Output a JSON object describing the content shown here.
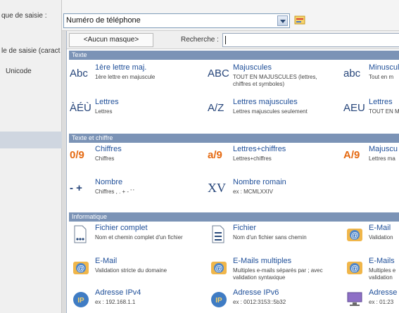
{
  "left_panel": {
    "rows": [
      "que de saisie :",
      "le de saisie (caract",
      "Unicode"
    ]
  },
  "combo": {
    "value": "Numéro de téléphone"
  },
  "toolbar": {
    "no_mask_label": "<Aucun masque>",
    "search_label": "Recherche :",
    "search_value": ""
  },
  "sections": [
    "Texte",
    "Texte et chiffre",
    "Informatique"
  ],
  "items": {
    "texte": [
      {
        "icon": "Abc",
        "title": "1ère lettre maj.",
        "desc": "1ère lettre en majuscule",
        "desc2": ""
      },
      {
        "icon": "ABC",
        "title": "Majuscules",
        "desc": "TOUT EN MAJUSCULES (lettres,",
        "desc2": "chiffres et symboles)"
      },
      {
        "icon": "abc",
        "title": "Minuscul",
        "desc": "Tout en m",
        "desc2": ""
      },
      {
        "icon": "ÀÉÙ",
        "title": "Lettres",
        "desc": "Lettres",
        "desc2": ""
      },
      {
        "icon": "A/Z",
        "title": "Lettres majuscules",
        "desc": "Lettres majuscules seulement",
        "desc2": ""
      },
      {
        "icon": "AEU",
        "title": "Lettres",
        "desc": "TOUT EN M",
        "desc2": ""
      }
    ],
    "texte_chiffre": [
      {
        "icon": "0/9",
        "title": "Chiffres",
        "desc": "Chiffres",
        "desc2": ""
      },
      {
        "icon": "a/9",
        "title": "Lettres+chiffres",
        "desc": "Lettres+chiffres",
        "desc2": ""
      },
      {
        "icon": "A/9",
        "title": "Majuscu",
        "desc": "Lettres ma",
        "desc2": ""
      },
      {
        "icon": "- +",
        "title": "Nombre",
        "desc": "Chiffres , . + - ' '",
        "desc2": ""
      },
      {
        "icon": "XV",
        "title": "Nombre romain",
        "desc": "ex : MCMLXXIV",
        "desc2": ""
      }
    ],
    "informatique": [
      {
        "icon": "file-dots-icon",
        "title": "Fichier complet",
        "desc": "Nom et chemin complet d'un fichier",
        "desc2": ""
      },
      {
        "icon": "file-lines-icon",
        "title": "Fichier",
        "desc": "Nom d'un fichier sans chemin",
        "desc2": ""
      },
      {
        "icon": "at-icon",
        "title": "E-Mail",
        "desc": "Validation",
        "desc2": ""
      },
      {
        "icon": "at-icon",
        "title": "E-Mail",
        "desc": "Validation stricte du domaine",
        "desc2": ""
      },
      {
        "icon": "at-icon",
        "title": "E-Mails multiples",
        "desc": "Multiples e-mails séparés par ; avec",
        "desc2": "validation syntaxique"
      },
      {
        "icon": "at-icon",
        "title": "E-Mails",
        "desc": "Multiples e",
        "desc2": "validation"
      },
      {
        "icon": "ip-icon",
        "title": "Adresse IPv4",
        "desc": "ex : 192.168.1.1",
        "desc2": ""
      },
      {
        "icon": "ip-icon",
        "title": "Adresse IPv6",
        "desc": "ex : 0012:3153::5b32",
        "desc2": ""
      },
      {
        "icon": "mac-icon",
        "title": "Adresse",
        "desc": "ex : 01:23",
        "desc2": ""
      }
    ]
  }
}
